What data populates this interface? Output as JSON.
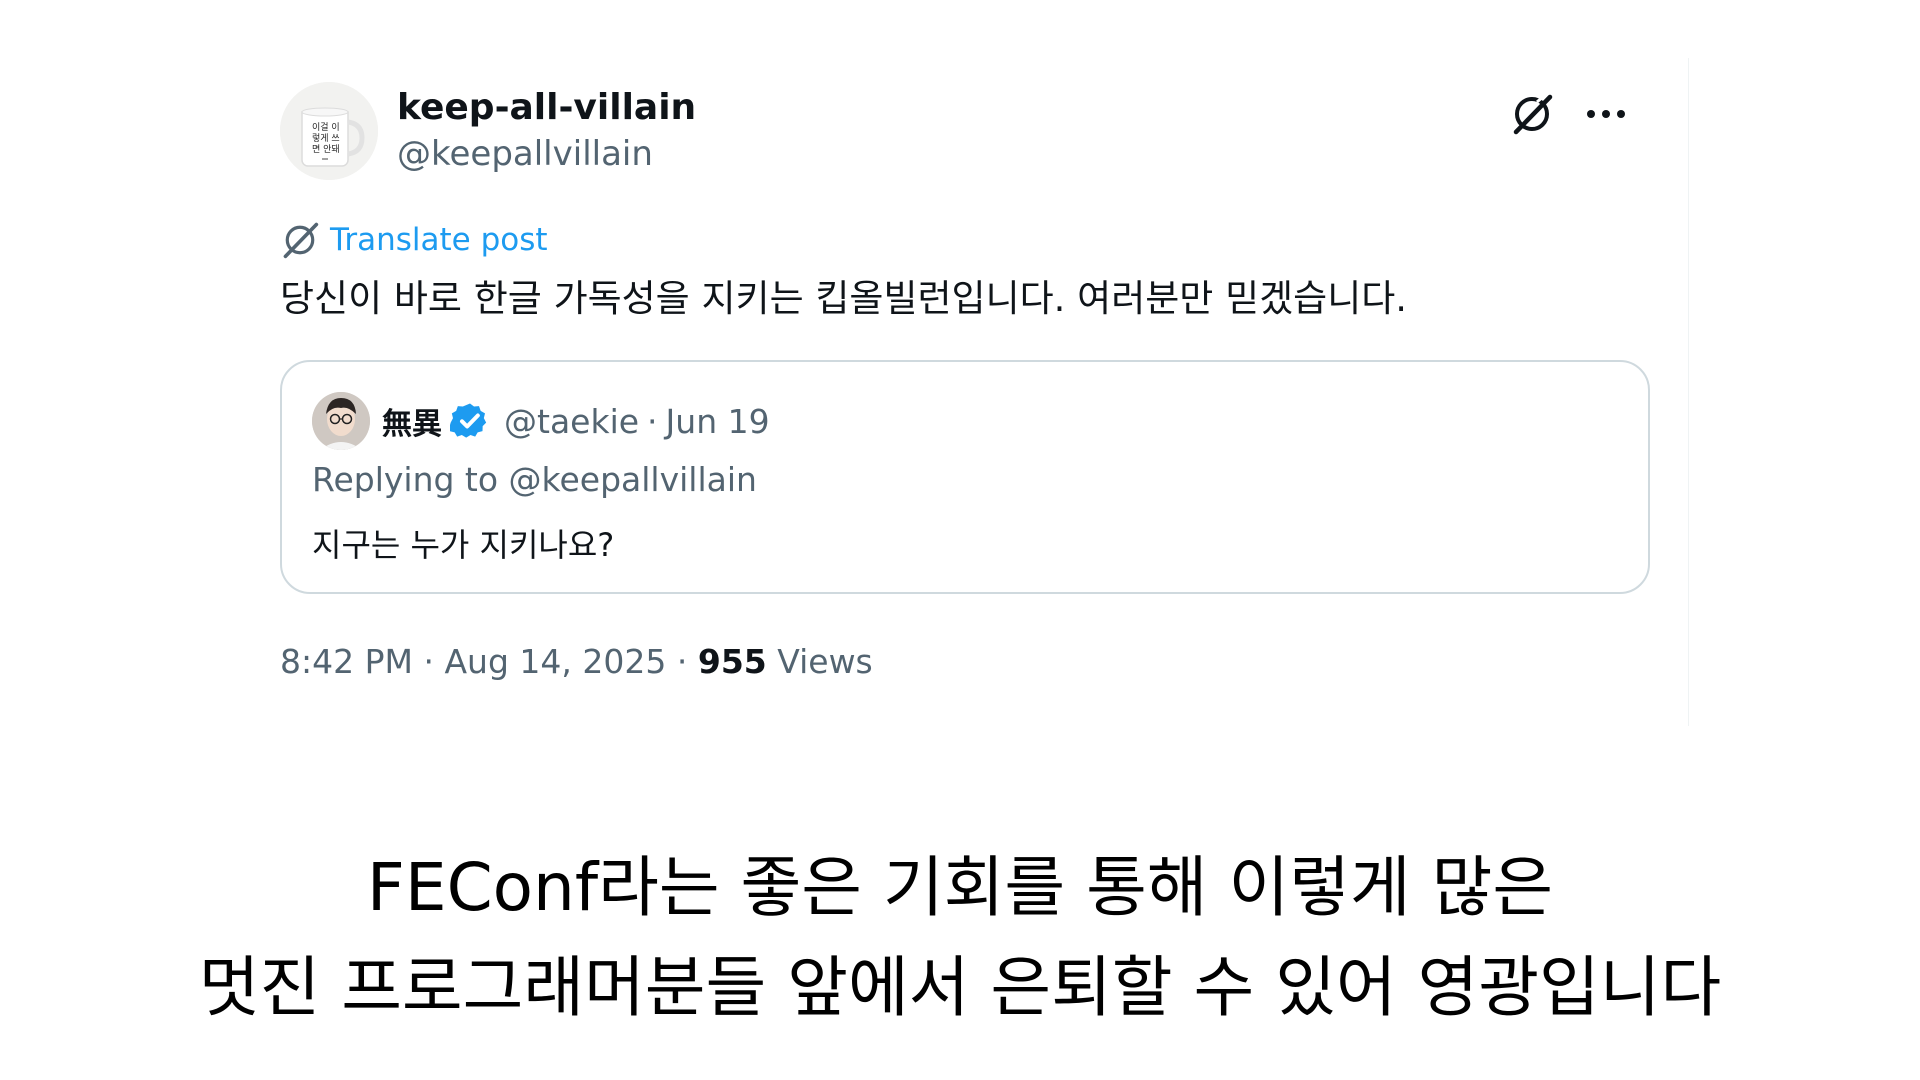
{
  "post": {
    "display_name": "keep-all-villain",
    "handle": "@keepallvillain",
    "avatar_text": "이걸 이 렇게 쓰 면 안돼",
    "translate_label": "Translate post",
    "text": "당신이 바로 한글 가독성을 지키는 킵올빌런입니다. 여러분만 믿겠습니다.",
    "time": "8:42 PM",
    "date": "Aug 14, 2025",
    "views_count": "955",
    "views_label": "Views",
    "separator": "·",
    "icons": [
      "grok-icon",
      "more-icon",
      "translate-icon"
    ],
    "accent_color": "#1d9bf0"
  },
  "quote": {
    "display_name": "無異",
    "handle": "@taekie",
    "date": "Jun 19",
    "separator": "·",
    "replying_to": "Replying to @keepallvillain",
    "text": "지구는 누가 지키나요?",
    "verified_color": "#1d9bf0"
  },
  "caption": {
    "line1": "FEConf라는 좋은 기회를 통해 이렇게 많은",
    "line2": "멋진 프로그래머분들 앞에서 은퇴할 수 있어 영광입니다"
  }
}
